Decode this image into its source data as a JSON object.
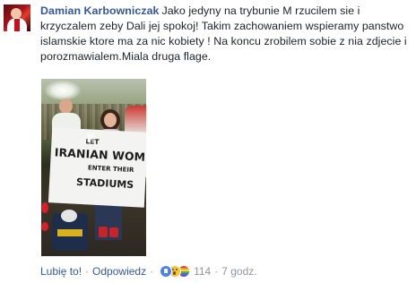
{
  "comment": {
    "author": "Damian Karbowniczak",
    "text": "Jako jedyny na trybunie M rzucilem sie i krzyczalem zeby Dali jej spokoj! Takim zachowaniem wspieramy panstwo islamskie ktore ma za nic kobiety ! Na koncu zrobilem sobie z nia zdjecie i porozmawialem.Miala druga flage.",
    "photo": {
      "banner_line_1": "LET",
      "banner_line_2": "IRANIAN WOM",
      "banner_line_3": "ENTER THEIR",
      "banner_line_4": "STADIUMS"
    }
  },
  "actions": {
    "like_label": "Lubię to!",
    "separator": "·",
    "reply_label": "Odpowiedz",
    "reactions": [
      "like-reaction-icon",
      "wow-reaction-icon",
      "pride-reaction-icon"
    ],
    "reaction_count": "114",
    "timestamp": "7 godz."
  },
  "colors": {
    "author": "#365899",
    "body_text": "#1d2129",
    "meta": "#90949c"
  }
}
